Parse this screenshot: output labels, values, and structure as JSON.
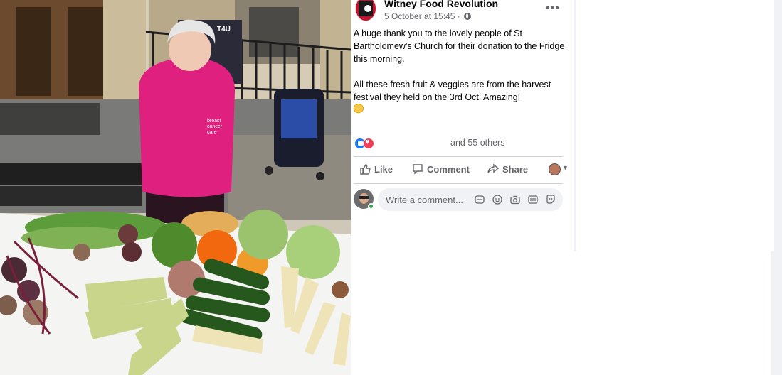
{
  "post": {
    "page_name": "Witney Food Revolution",
    "timestamp": "5 October at 15:45 ·",
    "body": [
      "A huge thank you to the lovely people of St Bartholomew's Church for their donation to the Fridge this morning.",
      "All these fresh fruit & veggies are from the harvest festival they held on the 3rd Oct. Amazing!"
    ],
    "reactions_text": "and 55 others",
    "actions": {
      "like": "Like",
      "comment": "Comment",
      "share": "Share"
    },
    "comment_placeholder": "Write a comment..."
  },
  "colors": {
    "accent": "#1877f2",
    "love": "#f33e58",
    "secondary_text": "#65676b",
    "online": "#31a24c"
  },
  "icons": [
    "page-avatar",
    "globe-icon",
    "more-icon",
    "like-reaction-icon",
    "love-reaction-icon",
    "like-icon",
    "comment-icon",
    "share-icon",
    "caret-down-icon",
    "sticker-icon",
    "emoji-icon",
    "camera-icon",
    "gif-icon",
    "avatar-sticker-icon"
  ],
  "photo": {
    "sweatshirt_logo": [
      "breast",
      "cancer",
      "care"
    ],
    "poster_text": "T4U"
  }
}
